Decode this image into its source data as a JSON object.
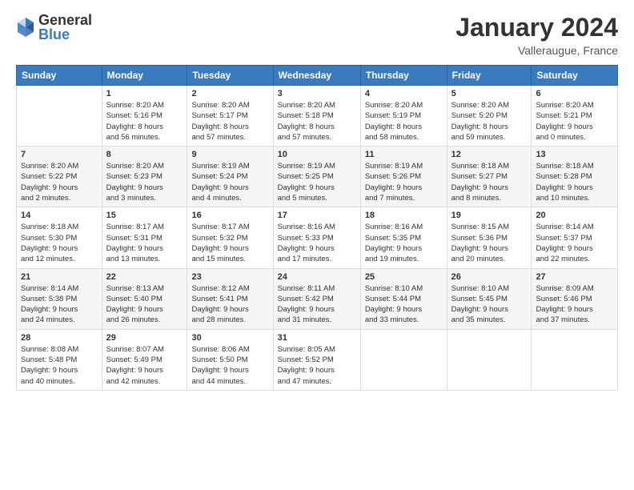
{
  "logo": {
    "general": "General",
    "blue": "Blue"
  },
  "header": {
    "title": "January 2024",
    "location": "Valleraugue, France"
  },
  "days_of_week": [
    "Sunday",
    "Monday",
    "Tuesday",
    "Wednesday",
    "Thursday",
    "Friday",
    "Saturday"
  ],
  "weeks": [
    [
      {
        "day": "",
        "info": ""
      },
      {
        "day": "1",
        "info": "Sunrise: 8:20 AM\nSunset: 5:16 PM\nDaylight: 8 hours\nand 56 minutes."
      },
      {
        "day": "2",
        "info": "Sunrise: 8:20 AM\nSunset: 5:17 PM\nDaylight: 8 hours\nand 57 minutes."
      },
      {
        "day": "3",
        "info": "Sunrise: 8:20 AM\nSunset: 5:18 PM\nDaylight: 8 hours\nand 57 minutes."
      },
      {
        "day": "4",
        "info": "Sunrise: 8:20 AM\nSunset: 5:19 PM\nDaylight: 8 hours\nand 58 minutes."
      },
      {
        "day": "5",
        "info": "Sunrise: 8:20 AM\nSunset: 5:20 PM\nDaylight: 8 hours\nand 59 minutes."
      },
      {
        "day": "6",
        "info": "Sunrise: 8:20 AM\nSunset: 5:21 PM\nDaylight: 9 hours\nand 0 minutes."
      }
    ],
    [
      {
        "day": "7",
        "info": "Sunrise: 8:20 AM\nSunset: 5:22 PM\nDaylight: 9 hours\nand 2 minutes."
      },
      {
        "day": "8",
        "info": "Sunrise: 8:20 AM\nSunset: 5:23 PM\nDaylight: 9 hours\nand 3 minutes."
      },
      {
        "day": "9",
        "info": "Sunrise: 8:19 AM\nSunset: 5:24 PM\nDaylight: 9 hours\nand 4 minutes."
      },
      {
        "day": "10",
        "info": "Sunrise: 8:19 AM\nSunset: 5:25 PM\nDaylight: 9 hours\nand 5 minutes."
      },
      {
        "day": "11",
        "info": "Sunrise: 8:19 AM\nSunset: 5:26 PM\nDaylight: 9 hours\nand 7 minutes."
      },
      {
        "day": "12",
        "info": "Sunrise: 8:18 AM\nSunset: 5:27 PM\nDaylight: 9 hours\nand 8 minutes."
      },
      {
        "day": "13",
        "info": "Sunrise: 8:18 AM\nSunset: 5:28 PM\nDaylight: 9 hours\nand 10 minutes."
      }
    ],
    [
      {
        "day": "14",
        "info": "Sunrise: 8:18 AM\nSunset: 5:30 PM\nDaylight: 9 hours\nand 12 minutes."
      },
      {
        "day": "15",
        "info": "Sunrise: 8:17 AM\nSunset: 5:31 PM\nDaylight: 9 hours\nand 13 minutes."
      },
      {
        "day": "16",
        "info": "Sunrise: 8:17 AM\nSunset: 5:32 PM\nDaylight: 9 hours\nand 15 minutes."
      },
      {
        "day": "17",
        "info": "Sunrise: 8:16 AM\nSunset: 5:33 PM\nDaylight: 9 hours\nand 17 minutes."
      },
      {
        "day": "18",
        "info": "Sunrise: 8:16 AM\nSunset: 5:35 PM\nDaylight: 9 hours\nand 19 minutes."
      },
      {
        "day": "19",
        "info": "Sunrise: 8:15 AM\nSunset: 5:36 PM\nDaylight: 9 hours\nand 20 minutes."
      },
      {
        "day": "20",
        "info": "Sunrise: 8:14 AM\nSunset: 5:37 PM\nDaylight: 9 hours\nand 22 minutes."
      }
    ],
    [
      {
        "day": "21",
        "info": "Sunrise: 8:14 AM\nSunset: 5:38 PM\nDaylight: 9 hours\nand 24 minutes."
      },
      {
        "day": "22",
        "info": "Sunrise: 8:13 AM\nSunset: 5:40 PM\nDaylight: 9 hours\nand 26 minutes."
      },
      {
        "day": "23",
        "info": "Sunrise: 8:12 AM\nSunset: 5:41 PM\nDaylight: 9 hours\nand 28 minutes."
      },
      {
        "day": "24",
        "info": "Sunrise: 8:11 AM\nSunset: 5:42 PM\nDaylight: 9 hours\nand 31 minutes."
      },
      {
        "day": "25",
        "info": "Sunrise: 8:10 AM\nSunset: 5:44 PM\nDaylight: 9 hours\nand 33 minutes."
      },
      {
        "day": "26",
        "info": "Sunrise: 8:10 AM\nSunset: 5:45 PM\nDaylight: 9 hours\nand 35 minutes."
      },
      {
        "day": "27",
        "info": "Sunrise: 8:09 AM\nSunset: 5:46 PM\nDaylight: 9 hours\nand 37 minutes."
      }
    ],
    [
      {
        "day": "28",
        "info": "Sunrise: 8:08 AM\nSunset: 5:48 PM\nDaylight: 9 hours\nand 40 minutes."
      },
      {
        "day": "29",
        "info": "Sunrise: 8:07 AM\nSunset: 5:49 PM\nDaylight: 9 hours\nand 42 minutes."
      },
      {
        "day": "30",
        "info": "Sunrise: 8:06 AM\nSunset: 5:50 PM\nDaylight: 9 hours\nand 44 minutes."
      },
      {
        "day": "31",
        "info": "Sunrise: 8:05 AM\nSunset: 5:52 PM\nDaylight: 9 hours\nand 47 minutes."
      },
      {
        "day": "",
        "info": ""
      },
      {
        "day": "",
        "info": ""
      },
      {
        "day": "",
        "info": ""
      }
    ]
  ]
}
